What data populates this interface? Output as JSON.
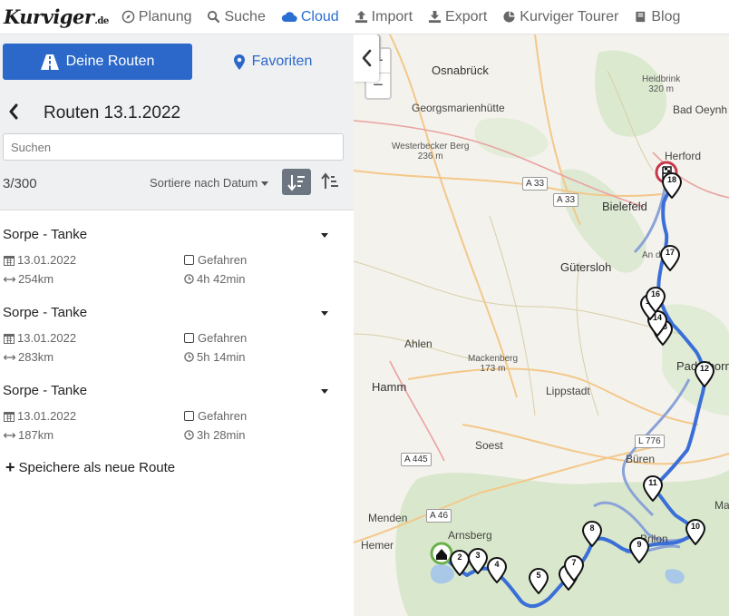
{
  "app": {
    "logo_text": "Kurviger",
    "logo_tld": ".de"
  },
  "nav": [
    {
      "label": "Planung",
      "icon": "compass-icon"
    },
    {
      "label": "Suche",
      "icon": "search-icon"
    },
    {
      "label": "Cloud",
      "icon": "cloud-icon",
      "active": true
    },
    {
      "label": "Import",
      "icon": "upload-icon"
    },
    {
      "label": "Export",
      "icon": "download-icon"
    },
    {
      "label": "Kurviger Tourer",
      "icon": "tourer-icon"
    },
    {
      "label": "Blog",
      "icon": "book-icon"
    }
  ],
  "tabs": {
    "routes_label": "Deine Routen",
    "favorites_label": "Favoriten"
  },
  "header": {
    "title": "Routen 13.1.2022",
    "search_placeholder": "Suchen",
    "count": "3/300",
    "sort_label": "Sortiere nach Datum"
  },
  "routes": [
    {
      "name": "Sorpe - Tanke",
      "date": "13.01.2022",
      "distance": "254km",
      "driven_label": "Gefahren",
      "driven": false,
      "duration": "4h 42min"
    },
    {
      "name": "Sorpe - Tanke",
      "date": "13.01.2022",
      "distance": "283km",
      "driven_label": "Gefahren",
      "driven": false,
      "duration": "5h 14min"
    },
    {
      "name": "Sorpe - Tanke",
      "date": "13.01.2022",
      "distance": "187km",
      "driven_label": "Gefahren",
      "driven": false,
      "duration": "3h 28min"
    }
  ],
  "save_new_label": "Speichere als neue Route",
  "map": {
    "zoom_in": "+",
    "zoom_out": "−",
    "places": {
      "osnabrueck": "Osnabrück",
      "georgsmarienhuette": "Georgsmarienhütte",
      "westerbecker": "Westerbecker Berg",
      "westerbecker_elev": "236 m",
      "heidbrink": "Heidbrink",
      "heidbrink_elev": "320 m",
      "bad_oeynh": "Bad Oeynh",
      "herford": "Herford",
      "bielefeld": "Bielefeld",
      "guetersloh": "Gütersloh",
      "ahlen": "Ahlen",
      "mackenberg": "Mackenberg",
      "mackenberg_elev": "173 m",
      "hamm": "Hamm",
      "lippstadt": "Lippstadt",
      "paderborn": "Paderborn",
      "soest": "Soest",
      "bueren": "Büren",
      "menden": "Menden",
      "arnsberg": "Arnsberg",
      "hemer": "Hemer",
      "brilon": "Brilon",
      "ma": "Ma",
      "an_der": "An der ..."
    },
    "roads": {
      "a33_1": "A 33",
      "a33_2": "A 33",
      "a445": "A 445",
      "a46": "A 46",
      "l776": "L 776"
    },
    "route_color": "#3a6fd8",
    "alt_route_color": "#8aa2d8",
    "start_color": "#6ab04c",
    "finish_color": "#c8384a",
    "markers": [
      "2",
      "3",
      "4",
      "5",
      "6",
      "7",
      "8",
      "9",
      "10",
      "11",
      "12",
      "13",
      "14",
      "15",
      "16",
      "17",
      "18"
    ]
  }
}
